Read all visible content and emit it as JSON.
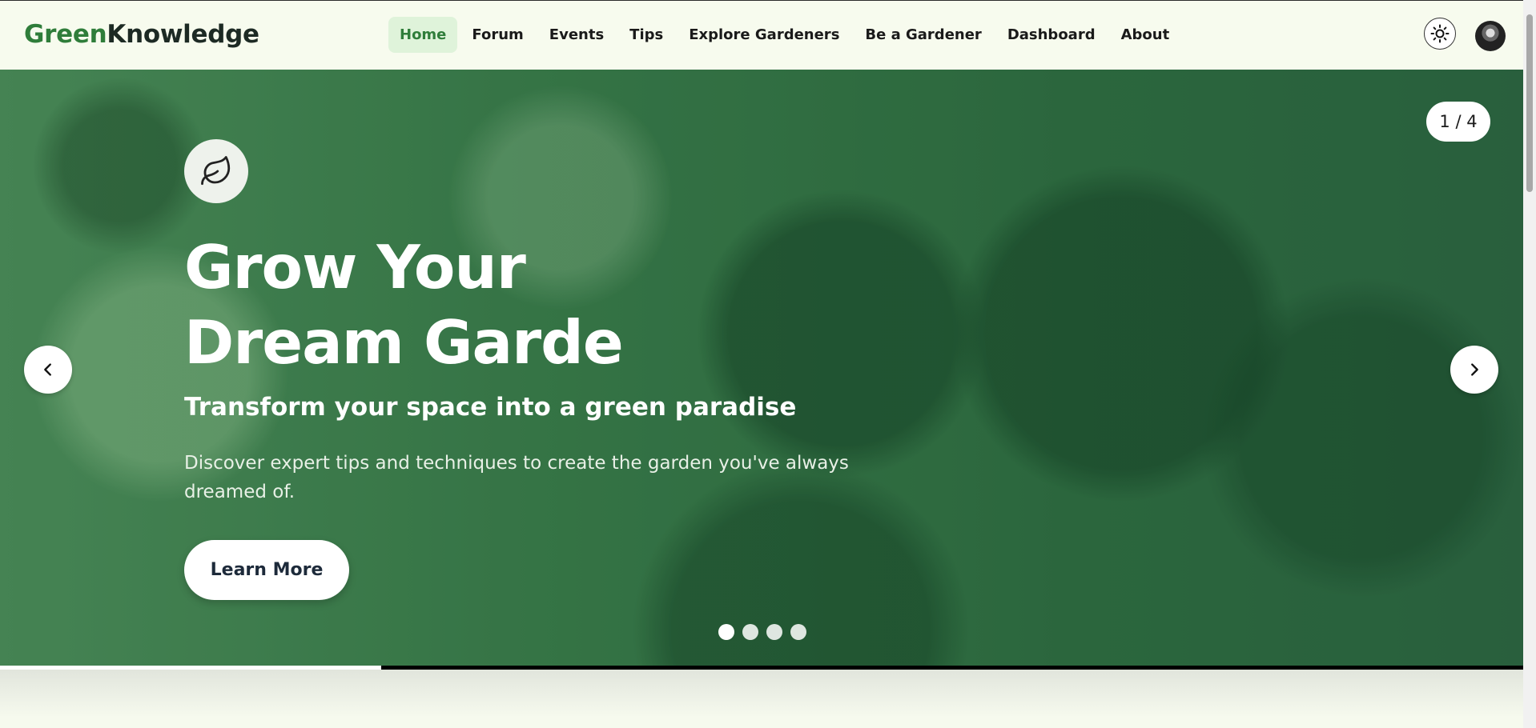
{
  "brand": {
    "part1": "Green",
    "part2": "Knowledge"
  },
  "nav": {
    "items": [
      {
        "label": "Home",
        "active": true
      },
      {
        "label": "Forum"
      },
      {
        "label": "Events"
      },
      {
        "label": "Tips"
      },
      {
        "label": "Explore Gardeners"
      },
      {
        "label": "Be a Gardener"
      },
      {
        "label": "Dashboard"
      },
      {
        "label": "About"
      }
    ]
  },
  "header_icons": {
    "theme_toggle": "sun-icon",
    "avatar": "user-avatar"
  },
  "hero": {
    "icon": "leaf-icon",
    "title": "Grow Your Dream Garde",
    "subtitle": "Transform your space into a green paradise",
    "description": "Discover expert tips and techniques to create the garden you've always dreamed of.",
    "button_label": "Learn More",
    "counter": "1 / 4",
    "slide_count": 4,
    "active_slide": 1,
    "progress": 0.25,
    "accent_color": "#2f7d3a"
  }
}
